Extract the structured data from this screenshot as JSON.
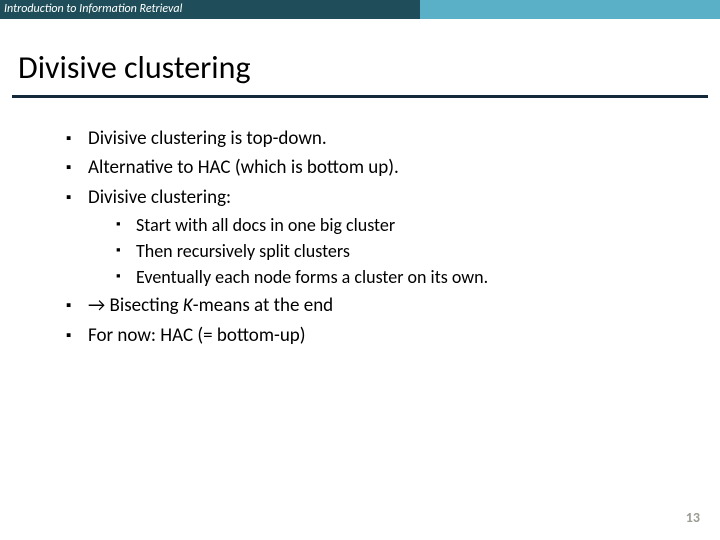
{
  "header": {
    "course_title": "Introduction to Information Retrieval"
  },
  "slide": {
    "title": "Divisive clustering",
    "page_number": "13"
  },
  "bullets": [
    {
      "text": "Divisive clustering is top-down."
    },
    {
      "text": "Alternative to HAC (which is bottom up)."
    },
    {
      "text": "Divisive clustering:",
      "sub": [
        "Start with all docs in one big cluster",
        "Then recursively split clusters",
        "Eventually each node forms a cluster on its own."
      ]
    },
    {
      "arrow": "→ ",
      "text_prefix": "Bisecting ",
      "ital": "K",
      "text_suffix": "-means at the end"
    },
    {
      "text": "For now: HAC (= bottom-up)"
    }
  ]
}
